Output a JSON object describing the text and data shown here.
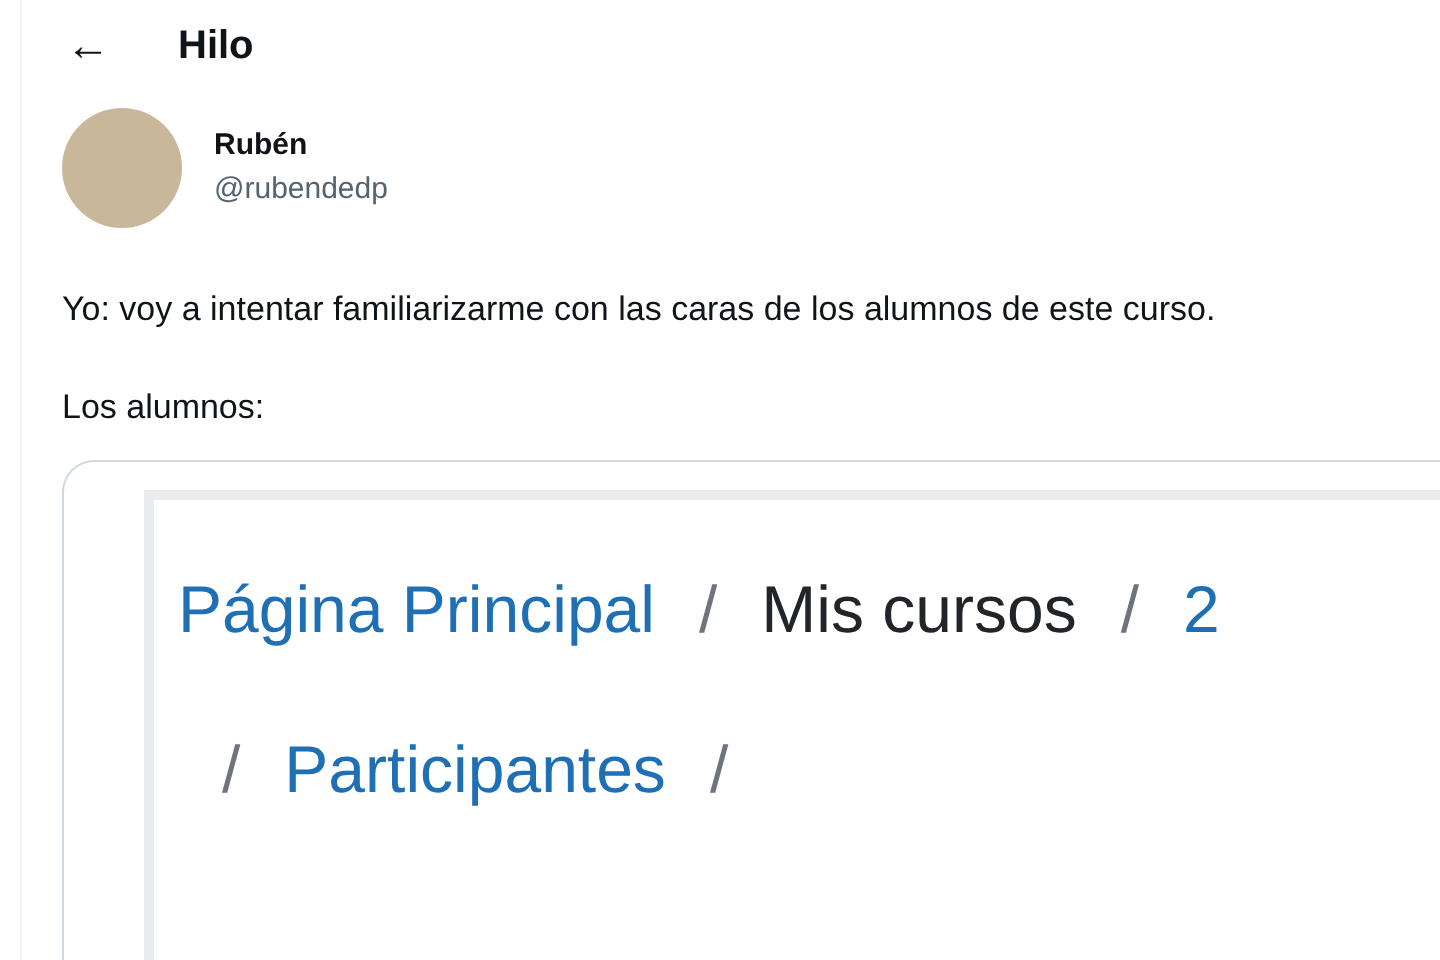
{
  "header": {
    "back_icon": "←",
    "title": "Hilo"
  },
  "tweet": {
    "author": {
      "name": "Rubén",
      "handle": "@rubendedp"
    },
    "text": "Yo: voy a intentar familiarizarme con las caras de los alumnos de este curso.",
    "caption": "Los alumnos:",
    "embedded_screenshot": {
      "breadcrumb_lines": [
        [
          {
            "kind": "link",
            "text": "Página Principal"
          },
          {
            "kind": "separator",
            "text": "/"
          },
          {
            "kind": "plain",
            "text": "Mis cursos"
          },
          {
            "kind": "separator",
            "text": "/"
          },
          {
            "kind": "link",
            "text": "2"
          }
        ],
        [
          {
            "kind": "separator",
            "text": "/"
          },
          {
            "kind": "link",
            "text": "Participantes"
          },
          {
            "kind": "separator",
            "text": "/"
          }
        ]
      ]
    }
  }
}
